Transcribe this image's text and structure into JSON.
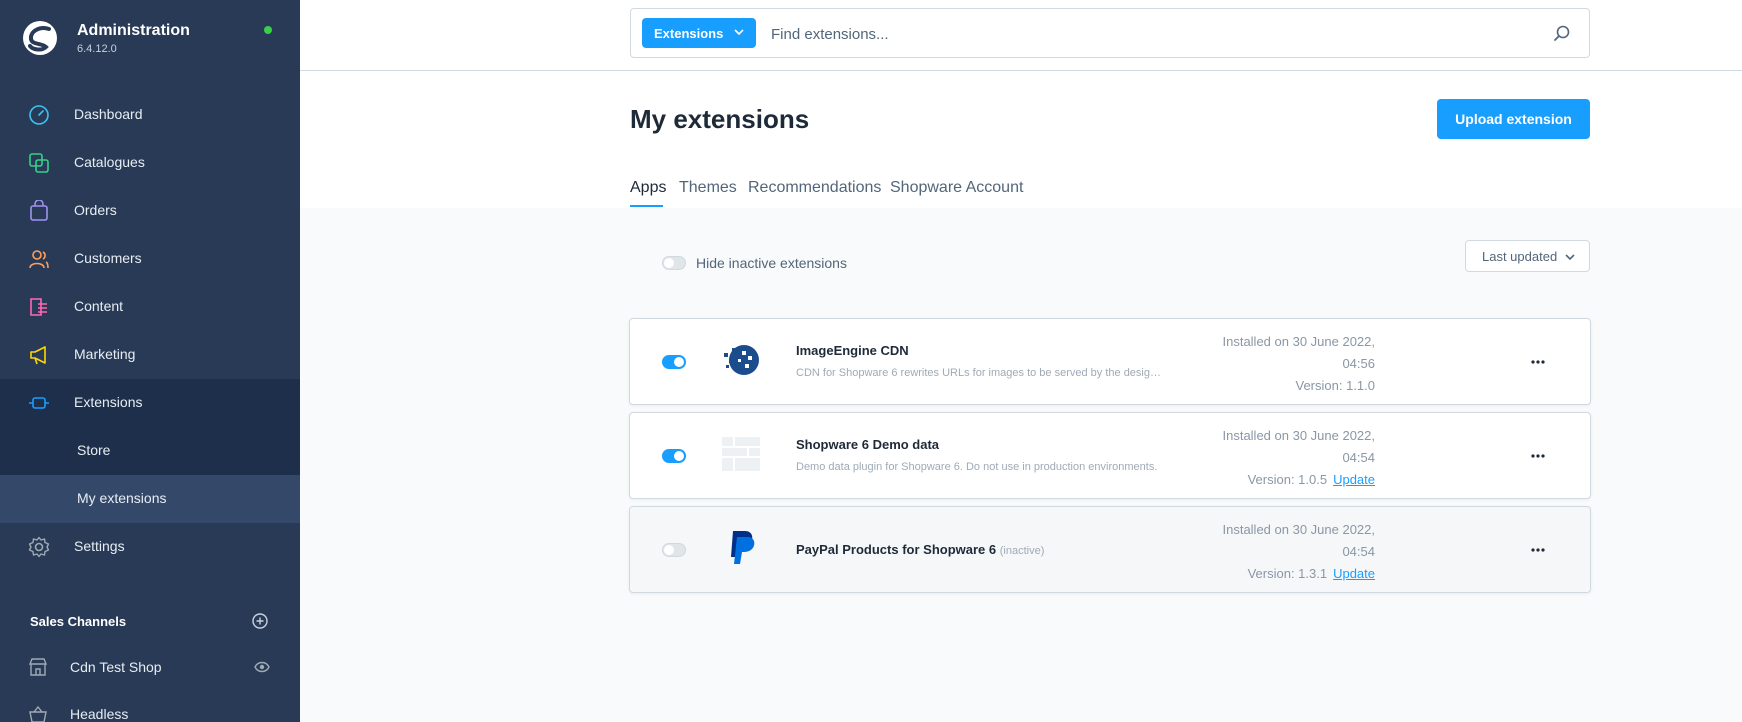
{
  "app": {
    "title": "Administration",
    "version": "6.4.12.0"
  },
  "sidebar": {
    "items": [
      {
        "label": "Dashboard",
        "icon": "dashboard-icon"
      },
      {
        "label": "Catalogues",
        "icon": "catalogue-icon"
      },
      {
        "label": "Orders",
        "icon": "orders-icon"
      },
      {
        "label": "Customers",
        "icon": "customers-icon"
      },
      {
        "label": "Content",
        "icon": "content-icon"
      },
      {
        "label": "Marketing",
        "icon": "marketing-icon"
      },
      {
        "label": "Extensions",
        "icon": "extensions-icon"
      }
    ],
    "sub_items": [
      {
        "label": "Store"
      },
      {
        "label": "My extensions"
      }
    ],
    "settings": {
      "label": "Settings"
    },
    "sales_channels": {
      "title": "Sales Channels",
      "items": [
        {
          "label": "Cdn Test Shop"
        },
        {
          "label": "Headless"
        }
      ]
    }
  },
  "search": {
    "type_label": "Extensions",
    "placeholder": "Find extensions..."
  },
  "page": {
    "title": "My extensions",
    "upload_label": "Upload extension"
  },
  "tabs": [
    "Apps",
    "Themes",
    "Recommendations",
    "Shopware Account"
  ],
  "filters": {
    "hide_inactive_label": "Hide inactive extensions",
    "sort_label": "Last updated"
  },
  "extensions": [
    {
      "name": "ImageEngine CDN",
      "description": "CDN for Shopware 6 rewrites URLs for images to be served by the designated CDN domain",
      "installed_line1": "Installed on 30 June 2022,",
      "installed_line2": "04:56",
      "version": "Version: 1.1.0",
      "update": "",
      "active": true
    },
    {
      "name": "Shopware 6 Demo data",
      "description": "Demo data plugin for Shopware 6. Do not use in production environments.",
      "installed_line1": "Installed on 30 June 2022,",
      "installed_line2": "04:54",
      "version": "Version: 1.0.5",
      "update": "Update",
      "active": true
    },
    {
      "name": "PayPal Products for Shopware 6",
      "inactive_tag": "(inactive)",
      "installed_line1": "Installed on 30 June 2022,",
      "installed_line2": "04:54",
      "version": "Version: 1.3.1",
      "update": "Update",
      "active": false
    }
  ],
  "colors": {
    "sidebar": "#283a56",
    "accent": "#189eff",
    "online": "#37d046"
  }
}
